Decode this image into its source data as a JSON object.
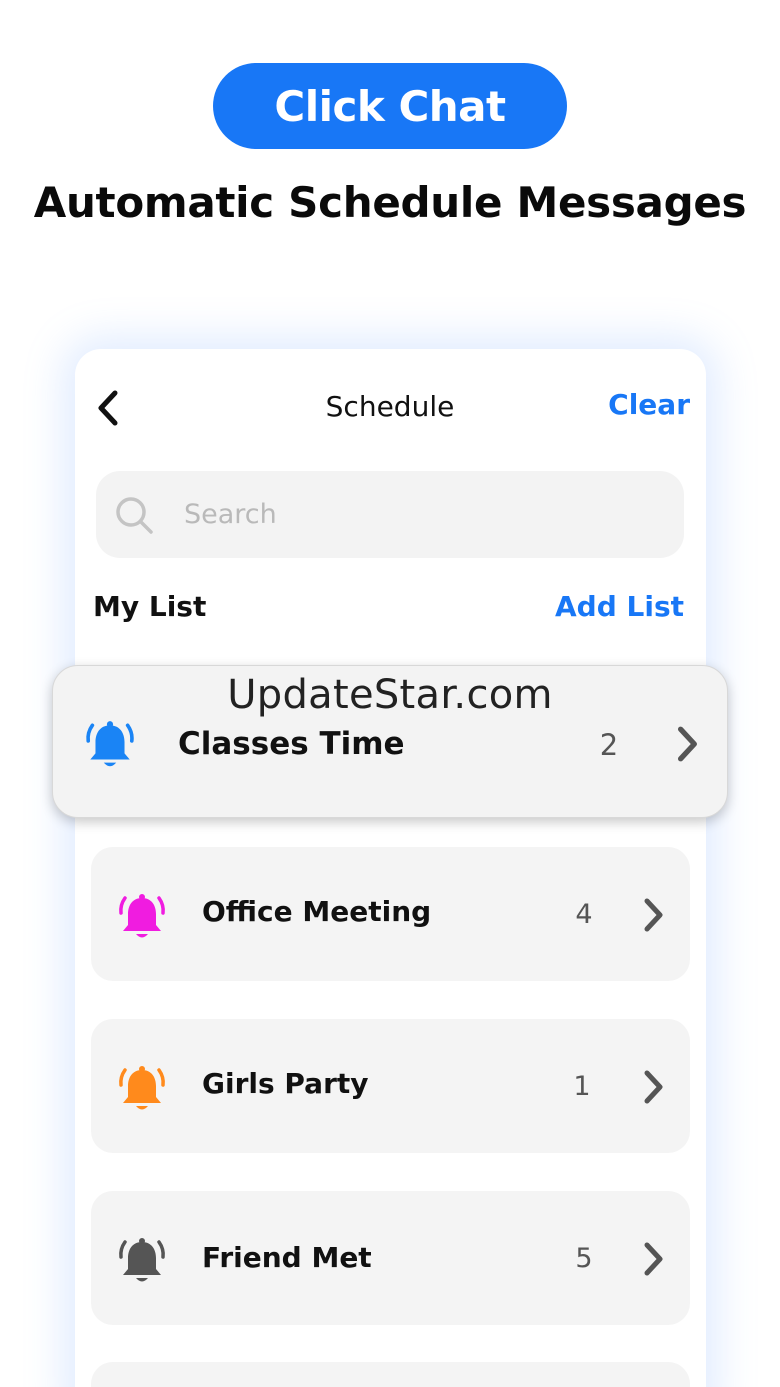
{
  "promo": {
    "badge": "Click Chat",
    "headline": "Automatic Schedule Messages"
  },
  "header": {
    "title": "Schedule",
    "clear_label": "Clear"
  },
  "search": {
    "placeholder": "Search",
    "value": ""
  },
  "list_section": {
    "title": "My List",
    "add_label": "Add List"
  },
  "lists": [
    {
      "label": "Classes Time",
      "count": "2",
      "bell_color": "#1a84f5",
      "icon": "bell-icon"
    },
    {
      "label": "Office Meeting",
      "count": "4",
      "bell_color": "#f01ce0",
      "icon": "bell-icon"
    },
    {
      "label": "Girls Party",
      "count": "1",
      "bell_color": "#ff8a1c",
      "icon": "bell-icon"
    },
    {
      "label": "Friend Met",
      "count": "5",
      "bell_color": "#555555",
      "icon": "bell-icon"
    }
  ],
  "watermark": "UpdateStar.com",
  "colors": {
    "accent": "#1877f6"
  }
}
